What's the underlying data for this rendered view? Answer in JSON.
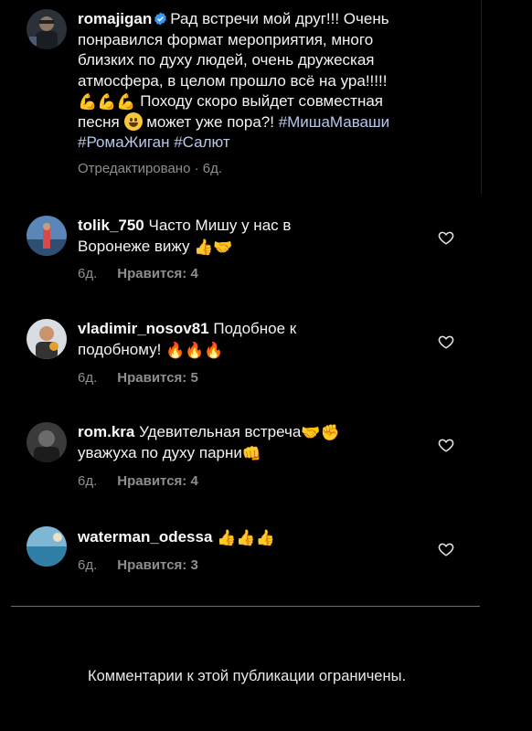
{
  "post": {
    "username": "romajigan",
    "lines": [
      "Рад встречи мой друг!!! Очень",
      "понравился формат мероприятия, много",
      "близких по духу людей, очень дружеская",
      "атмосфера, в целом прошло всё на ура!!!!!",
      "💪💪💪",
      "Походу скоро выйдет совместная",
      "песня",
      "😀",
      "может уже пора?!",
      "#МишаМаваши",
      "#РомаЖиган #Салют"
    ],
    "meta": "Отредактировано · 6д."
  },
  "comments": [
    {
      "username": "tolik_750",
      "text_line1": "Часто Мишу у нас в",
      "text_line2": "Воронеже вижу",
      "emoji": "👍🤝",
      "age": "6д.",
      "likes": "Нравится: 4"
    },
    {
      "username": "vladimir_nosov81",
      "text_line1": "Подобное к",
      "text_line2": "подобному!",
      "emoji": "🔥🔥🔥",
      "age": "6д.",
      "likes": "Нравится: 5"
    },
    {
      "username": "rom.kra",
      "text_line1": "Удевительная встреча",
      "emoji1": "🤝✊",
      "text_line2": "уважуха по духу парни",
      "emoji2": "👊",
      "age": "6д.",
      "likes": "Нравится: 4"
    },
    {
      "username": "waterman_odessa",
      "emoji": "👍👍👍",
      "age": "6д.",
      "likes": "Нравится: 3"
    }
  ],
  "footer": "Комментарии к этой публикации ограничены.",
  "colors": {
    "background": "#000000",
    "text": "#f3f3f3",
    "secondary": "#8e8e8e",
    "hashtag": "#b9c7ea",
    "verified": "#3897f0"
  }
}
